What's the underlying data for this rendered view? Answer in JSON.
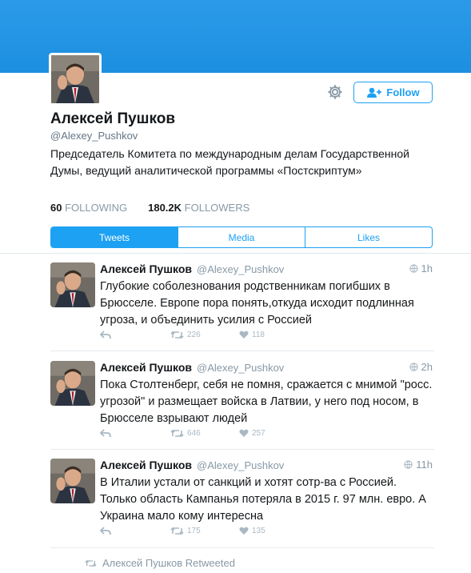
{
  "profile": {
    "name": "Алексей Пушков",
    "handle": "@Alexey_Pushkov",
    "bio": "Председатель Комитета по международным делам Государственной Думы, ведущий аналитической программы «Постскриптум»",
    "following_count": "60",
    "following_label": "FOLLOWING",
    "followers_count": "180.2K",
    "followers_label": "FOLLOWERS",
    "follow_label": "Follow"
  },
  "colors": {
    "accent": "#1da1f2",
    "banner": "#2b9be8",
    "muted": "#8899a6"
  },
  "tabs": [
    {
      "label": "Tweets",
      "active": true
    },
    {
      "label": "Media",
      "active": false
    },
    {
      "label": "Likes",
      "active": false
    }
  ],
  "tweets": [
    {
      "name": "Алексей Пушков",
      "handle": "@Alexey_Pushkov",
      "time": "1h",
      "text": "Глубокие соболезнования родственникам погибших в Брюсселе. Европе пора понять,откуда исходит подлинная угроза, и объединить усилия с Россией",
      "retweets": "226",
      "likes": "118"
    },
    {
      "name": "Алексей Пушков",
      "handle": "@Alexey_Pushkov",
      "time": "2h",
      "text": "Пока Столтенберг, себя не помня, сражается с мнимой \"росс. угрозой\" и размещает войска в Латвии, у него под носом, в Брюсселе взрывают людей",
      "retweets": "646",
      "likes": "257"
    },
    {
      "name": "Алексей Пушков",
      "handle": "@Alexey_Pushkov",
      "time": "11h",
      "text": "В Италии устали от санкций и хотят сотр-ва с Россией. Только область Кампанья потеряла в 2015 г. 97 млн. евро. А Украина мало кому интересна",
      "retweets": "175",
      "likes": "135"
    }
  ],
  "retweeted_label": "Алексей Пушков Retweeted"
}
